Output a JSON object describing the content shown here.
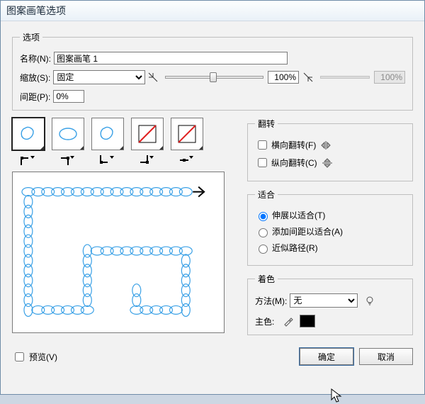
{
  "title": "图案画笔选项",
  "options": {
    "legend": "选项",
    "name_label": "名称(N):",
    "name_value": "图案画笔 1",
    "scale_label": "缩放(S):",
    "scale_mode": "固定",
    "scale_value": "100%",
    "scale_value2": "100%",
    "spacing_label": "间距(P):",
    "spacing_value": "0%"
  },
  "tiles": [
    {
      "name": "side-tile",
      "kind": "blob",
      "selected": true
    },
    {
      "name": "start-tile",
      "kind": "oval"
    },
    {
      "name": "end-tile",
      "kind": "blob"
    },
    {
      "name": "outer-corner-tile",
      "kind": "slash"
    },
    {
      "name": "inner-corner-tile",
      "kind": "slash"
    }
  ],
  "flip": {
    "legend": "翻转",
    "horiz_label": "横向翻转(F)",
    "horiz_checked": false,
    "vert_label": "纵向翻转(C)",
    "vert_checked": false
  },
  "fit": {
    "legend": "适合",
    "stretch_label": "伸展以适合(T)",
    "space_label": "添加间距以适合(A)",
    "approx_label": "近似路径(R)",
    "selected": "stretch"
  },
  "colorization": {
    "legend": "着色",
    "method_label": "方法(M):",
    "method_value": "无",
    "keycolor_label": "主色:"
  },
  "footer": {
    "preview_label": "预览(V)",
    "preview_checked": false,
    "ok_label": "确定",
    "cancel_label": "取消"
  }
}
